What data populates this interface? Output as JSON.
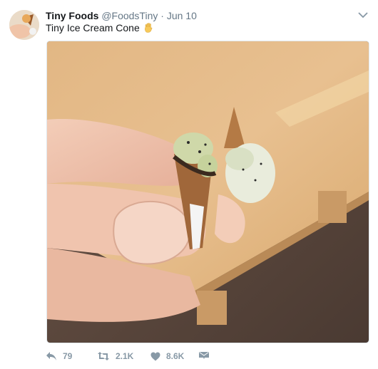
{
  "tweet": {
    "author_name": "Tiny Foods",
    "author_handle": "@FoodsTiny",
    "separator": "·",
    "date": "Jun 10",
    "text": "Tiny Ice Cream Cone",
    "text_emoji": "raised-hand-emoji",
    "photo_description_icon": "tiny-ice-cream-photo"
  },
  "actions": {
    "reply_count": "79",
    "retweet_count": "2.1K",
    "like_count": "8.6K"
  },
  "colors": {
    "text_primary": "#14171a",
    "text_secondary": "#657786",
    "action_gray": "#8899a6"
  }
}
